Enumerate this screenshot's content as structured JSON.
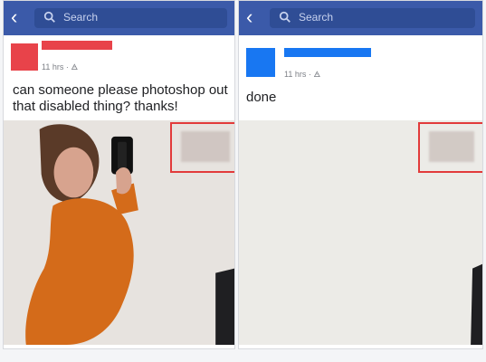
{
  "left": {
    "search_placeholder": "Search",
    "post": {
      "meta": "11 hrs · 🜁",
      "caption": "can someone please photoshop out that disabled thing? thanks!"
    }
  },
  "right": {
    "search_placeholder": "Search",
    "post": {
      "meta": "11 hrs · 🜁",
      "caption": "done"
    }
  },
  "colors": {
    "topbar": "#3b5aa9",
    "left_avatar": "#e8434a",
    "right_avatar": "#1877f2",
    "highlight_box": "#e23b3b"
  }
}
